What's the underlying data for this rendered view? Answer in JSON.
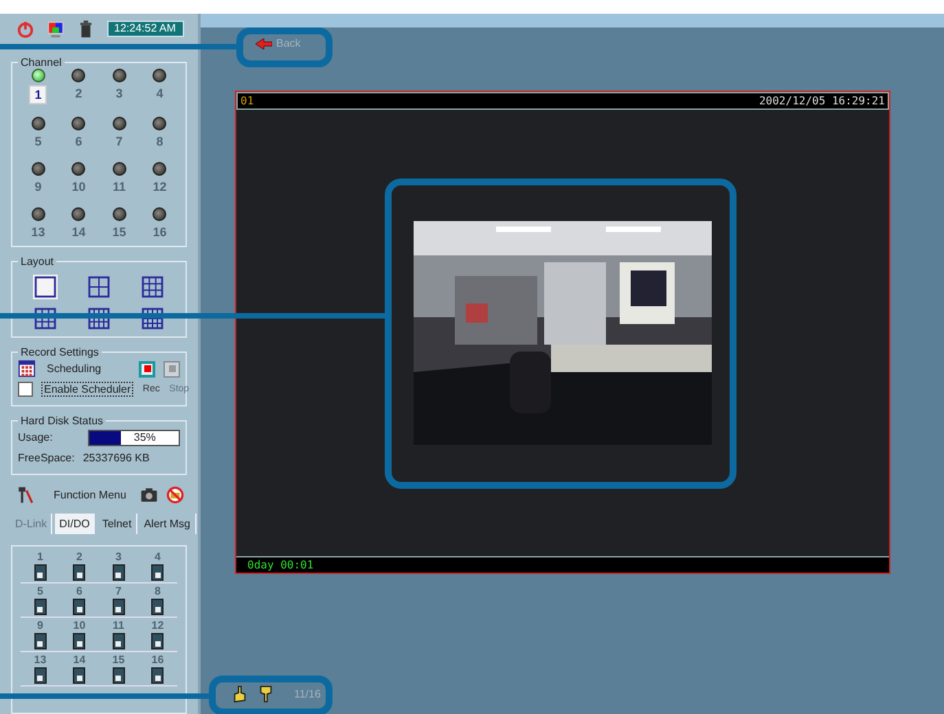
{
  "clock": "12:24:52 AM",
  "channel_panel": {
    "title": "Channel",
    "channels": [
      {
        "label": "1",
        "selected": true
      },
      {
        "label": "2",
        "selected": false
      },
      {
        "label": "3",
        "selected": false
      },
      {
        "label": "4",
        "selected": false
      },
      {
        "label": "5",
        "selected": false
      },
      {
        "label": "6",
        "selected": false
      },
      {
        "label": "7",
        "selected": false
      },
      {
        "label": "8",
        "selected": false
      },
      {
        "label": "9",
        "selected": false
      },
      {
        "label": "10",
        "selected": false
      },
      {
        "label": "11",
        "selected": false
      },
      {
        "label": "12",
        "selected": false
      },
      {
        "label": "13",
        "selected": false
      },
      {
        "label": "14",
        "selected": false
      },
      {
        "label": "15",
        "selected": false
      },
      {
        "label": "16",
        "selected": false
      }
    ]
  },
  "layout_panel": {
    "title": "Layout",
    "layouts": [
      {
        "kind": "single",
        "selected": true
      },
      {
        "kind": "quad",
        "selected": false
      },
      {
        "kind": "six",
        "selected": false
      },
      {
        "kind": "nine",
        "selected": false
      },
      {
        "kind": "twelve",
        "selected": false
      },
      {
        "kind": "sixteen",
        "selected": false
      }
    ]
  },
  "record_settings": {
    "title": "Record Settings",
    "scheduling": "Scheduling",
    "rec": {
      "label": "Rec",
      "disabled": false
    },
    "stop": {
      "label": "Stop",
      "disabled": true
    },
    "enable_scheduler": {
      "label": "Enable Scheduler",
      "checked": false
    }
  },
  "hard_disk": {
    "title": "Hard Disk Status",
    "usage_label": "Usage:",
    "level": 0.35,
    "reading": "35%",
    "free_space_label": "FreeSpace:",
    "free_space": "25337696 KB"
  },
  "function_menu": {
    "title": "Function Menu"
  },
  "tabs": [
    {
      "label": "D-Link",
      "selected": false,
      "disabled": true
    },
    {
      "label": "DI/DO",
      "selected": true,
      "disabled": false
    },
    {
      "label": "Telnet",
      "selected": false,
      "disabled": false
    },
    {
      "label": "Alert Msg",
      "selected": false,
      "disabled": false
    }
  ],
  "dido": [
    "1",
    "2",
    "3",
    "4",
    "5",
    "6",
    "7",
    "8",
    "9",
    "10",
    "11",
    "12",
    "13",
    "14",
    "15",
    "16"
  ],
  "back": "Back",
  "video": {
    "channel": "01",
    "timestamp": "2002/12/05 16:29:21",
    "elapsed": "0day 00:01",
    "kind": "picture"
  },
  "page_counter": "11/16"
}
